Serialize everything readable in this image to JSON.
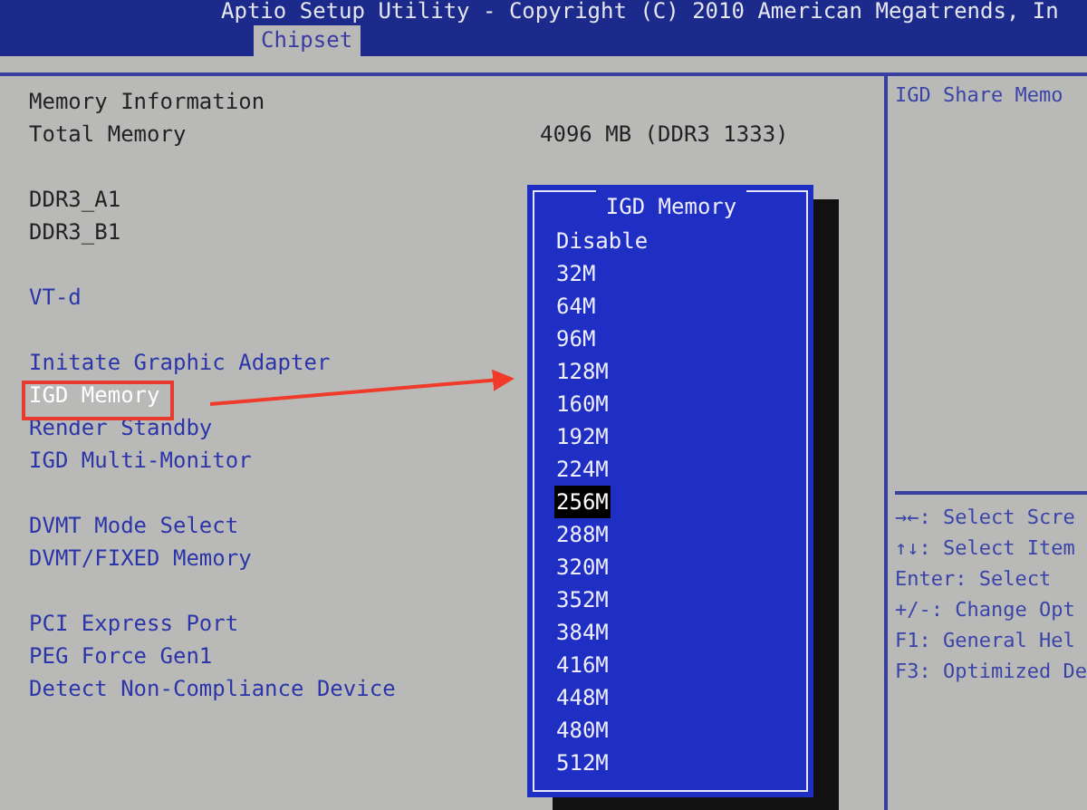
{
  "header": {
    "title": "Aptio Setup Utility - Copyright (C) 2010 American Megatrends, In",
    "tabs": [
      {
        "label": "Chipset",
        "selected": true
      }
    ]
  },
  "setting_groups": [
    {
      "items": [
        {
          "kind": "info",
          "label": "Memory Information",
          "selected": false
        },
        {
          "kind": "info",
          "label": "Total Memory",
          "value": "4096 MB (DDR3 1333)",
          "selected": false
        }
      ]
    },
    {
      "items": [
        {
          "kind": "info",
          "label": "DDR3_A1",
          "selected": false
        },
        {
          "kind": "info",
          "label": "DDR3_B1",
          "selected": false
        }
      ]
    },
    {
      "items": [
        {
          "kind": "setting",
          "label": "VT-d",
          "selected": false
        }
      ]
    },
    {
      "items": [
        {
          "kind": "setting",
          "label": "Initate Graphic Adapter",
          "selected": false
        },
        {
          "kind": "setting",
          "label": "IGD Memory",
          "selected": true
        },
        {
          "kind": "setting",
          "label": "Render Standby",
          "selected": false
        },
        {
          "kind": "setting",
          "label": "IGD Multi-Monitor",
          "selected": false
        }
      ]
    },
    {
      "items": [
        {
          "kind": "setting",
          "label": "DVMT Mode Select",
          "selected": false
        },
        {
          "kind": "setting",
          "label": "DVMT/FIXED Memory",
          "selected": false
        }
      ]
    },
    {
      "items": [
        {
          "kind": "setting",
          "label": "PCI Express Port",
          "selected": false
        },
        {
          "kind": "setting",
          "label": "PEG Force Gen1",
          "selected": false
        },
        {
          "kind": "setting",
          "label": "Detect Non-Compliance Device",
          "selected": false
        }
      ]
    }
  ],
  "popup": {
    "title": "IGD Memory",
    "options": [
      {
        "label": "Disable",
        "selected": false
      },
      {
        "label": "32M",
        "selected": false
      },
      {
        "label": "64M",
        "selected": false
      },
      {
        "label": "96M",
        "selected": false
      },
      {
        "label": "128M",
        "selected": false
      },
      {
        "label": "160M",
        "selected": false
      },
      {
        "label": "192M",
        "selected": false
      },
      {
        "label": "224M",
        "selected": false
      },
      {
        "label": "256M",
        "selected": true
      },
      {
        "label": "288M",
        "selected": false
      },
      {
        "label": "320M",
        "selected": false
      },
      {
        "label": "352M",
        "selected": false
      },
      {
        "label": "384M",
        "selected": false
      },
      {
        "label": "416M",
        "selected": false
      },
      {
        "label": "448M",
        "selected": false
      },
      {
        "label": "480M",
        "selected": false
      },
      {
        "label": "512M",
        "selected": false
      }
    ]
  },
  "help": {
    "text": "IGD Share Memo",
    "keys": [
      "→←: Select Scre",
      "↑↓: Select Item",
      "Enter: Select",
      "+/-: Change Opt",
      "F1: General Hel",
      "F3: Optimized De"
    ]
  }
}
